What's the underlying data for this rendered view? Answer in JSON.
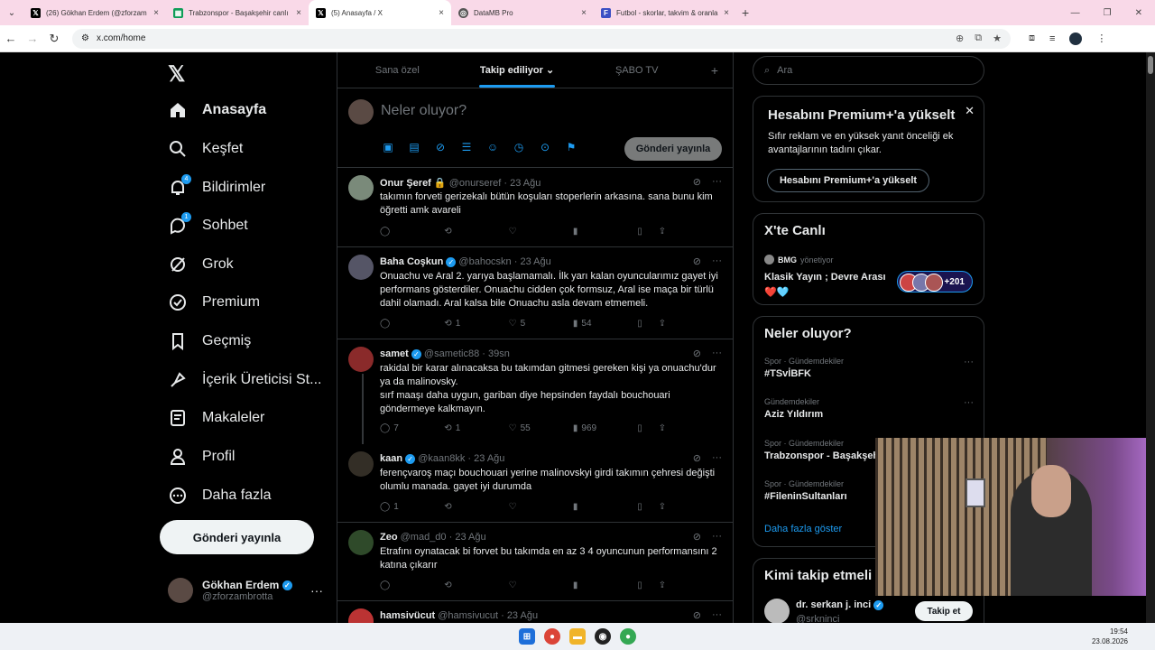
{
  "browser": {
    "tabs": [
      {
        "title": "(26) Gökhan Erdem (@zforzam",
        "icon": "x-icon"
      },
      {
        "title": "Trabzonspor - Başakşehir canlı",
        "icon": "sheets-icon"
      },
      {
        "title": "(5) Anasayfa / X",
        "icon": "x-icon",
        "active": true
      },
      {
        "title": "DataMB Pro",
        "icon": "globe-icon"
      },
      {
        "title": "Futbol - skorlar, takvim & oranla",
        "icon": "flashscore-icon"
      }
    ],
    "url": "x.com/home"
  },
  "nav": {
    "items": [
      {
        "label": "Anasayfa",
        "icon": "home-icon",
        "active": true
      },
      {
        "label": "Keşfet",
        "icon": "search-icon"
      },
      {
        "label": "Bildirimler",
        "icon": "bell-icon",
        "badge": "4"
      },
      {
        "label": "Sohbet",
        "icon": "chat-icon",
        "badge": "1"
      },
      {
        "label": "Grok",
        "icon": "grok-icon"
      },
      {
        "label": "Premium",
        "icon": "premium-icon"
      },
      {
        "label": "Geçmiş",
        "icon": "bookmark-icon"
      },
      {
        "label": "İçerik Üreticisi St...",
        "icon": "rocket-icon"
      },
      {
        "label": "Makaleler",
        "icon": "article-icon"
      },
      {
        "label": "Profil",
        "icon": "profile-icon"
      },
      {
        "label": "Daha fazla",
        "icon": "more-icon"
      }
    ],
    "post_button": "Gönderi yayınla",
    "account": {
      "name": "Gökhan Erdem",
      "handle": "@zforzambrotta"
    }
  },
  "feed": {
    "tabs": [
      "Sana özel",
      "Takip ediliyor",
      "ŞABO TV"
    ],
    "composer": {
      "placeholder": "Neler oluyor?",
      "post_label": "Gönderi yayınla"
    },
    "tweets": [
      {
        "name": "Onur Şeref",
        "handle": "@onurseref",
        "time": "23 Ağu",
        "text": "takımın forveti gerizekalı bütün koşuları stoperlerin arkasına. sana bunu kim öğretti amk avareli",
        "replies": "",
        "retweets": "",
        "likes": "",
        "views": ""
      },
      {
        "name": "Baha Coşkun",
        "handle": "@bahocskn",
        "time": "23 Ağu",
        "text": "Onuachu ve Aral 2. yarıya başlamamalı. İlk yarı kalan oyuncularımız gayet iyi performans gösterdiler. Onuachu cidden çok formsuz, Aral ise maça bir türlü dahil olamadı. Aral kalsa bile Onuachu asla devam etmemeli.",
        "replies": "",
        "retweets": "1",
        "likes": "5",
        "views": "54"
      },
      {
        "name": "samet",
        "handle": "@sametic88",
        "time": "39sn",
        "text": "rakidal bir karar alınacaksa bu takımdan gitmesi gereken kişi ya onuachu'dur ya da malinovsky.\nsırf maaşı daha uygun, gariban diye hepsinden faydalı bouchouari göndermeye kalkmayın.",
        "replies": "7",
        "retweets": "1",
        "likes": "55",
        "views": "969"
      },
      {
        "name": "kaan",
        "handle": "@kaan8kk",
        "time": "23 Ağu",
        "text": "ferençvaroş maçı bouchouari yerine malinovskyi girdi takımın çehresi değişti olumlu manada. gayet iyi durumda",
        "replies": "1",
        "retweets": "",
        "likes": "",
        "views": ""
      },
      {
        "name": "Zeo",
        "handle": "@mad_d0",
        "time": "23 Ağu",
        "text": "Etrafını oynatacak bi forvet bu takımda en az 3 4 oyuncunun performansını 2 katına çıkarır",
        "replies": "",
        "retweets": "",
        "likes": "",
        "views": ""
      },
      {
        "name": "hamsivücut",
        "handle": "@hamsivucut",
        "time": "23 Ağu"
      }
    ]
  },
  "sidebar": {
    "search_placeholder": "Ara",
    "premium": {
      "title": "Hesabını Premium+'a yükselt",
      "desc": "Sıfır reklam ve en yüksek yanıt önceliği ek avantajlarının tadını çıkar.",
      "button": "Hesabını Premium+'a yükselt"
    },
    "live": {
      "title": "X'te Canlı",
      "host": "BMG",
      "host_suffix": "yönetiyor",
      "stream_title": "Klasik Yayın ; Devre Arası",
      "hearts": "❤️🩵",
      "count": "+201"
    },
    "trends": {
      "title": "Neler oluyor?",
      "items": [
        {
          "category": "Spor · Gündemdekiler",
          "name": "#TSvİBFK"
        },
        {
          "category": "Gündemdekiler",
          "name": "Aziz Yıldırım"
        },
        {
          "category": "Spor · Gündemdekiler",
          "name": "Trabzonspor - Başakşehir"
        },
        {
          "category": "Spor · Gündemdekiler",
          "name": "#FileninSultanları"
        }
      ],
      "more": "Daha fazla göster"
    },
    "follow": {
      "title": "Kimi takip etmeli",
      "name": "dr. serkan j. inci",
      "handle": "@srkninci",
      "button": "Takip et"
    }
  },
  "taskbar": {
    "time": "19:54",
    "date": "23.08.2026"
  },
  "colors": {
    "accent": "#1d9bf0",
    "bg": "#000000",
    "border": "#2f3336"
  }
}
